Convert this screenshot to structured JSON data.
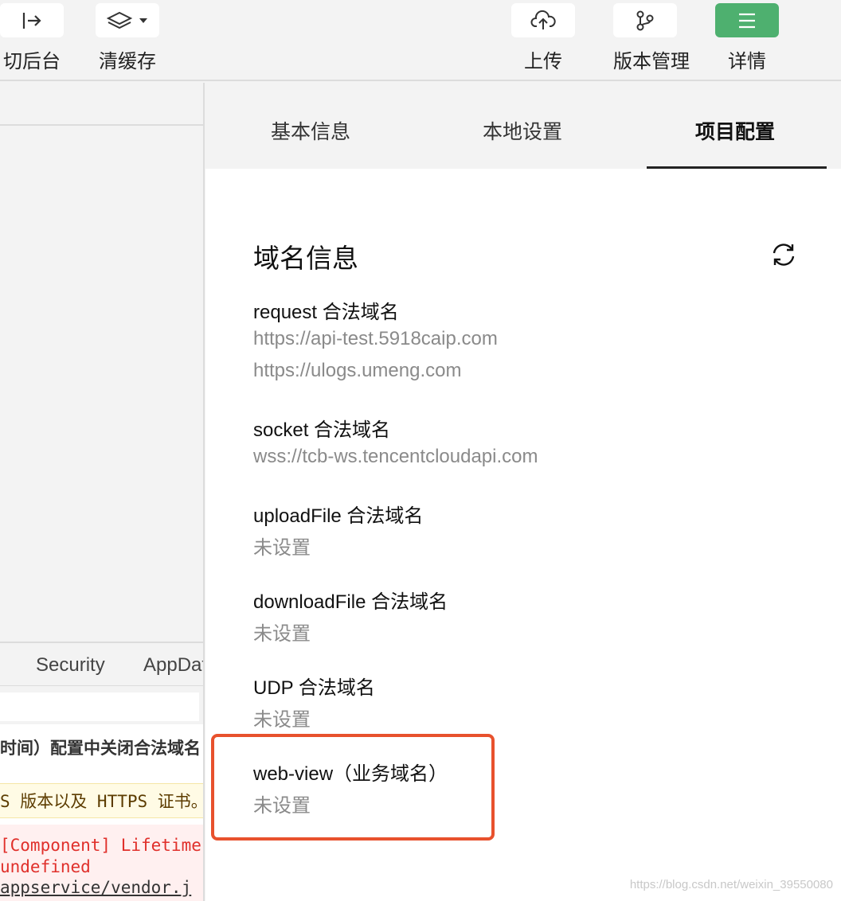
{
  "toolbar": {
    "switch_bg_label": "切后台",
    "clear_cache_label": "清缓存",
    "upload_label": "上传",
    "version_label": "版本管理",
    "details_label": "详情"
  },
  "left": {
    "tabs": [
      "Security",
      "AppDat"
    ],
    "console": {
      "line1": "时间）配置中关闭合法域名",
      "line2": "S 版本以及 HTTPS 证书。",
      "line3": "[Component] Lifetime",
      "line4": "undefined",
      "line5": "appservice/vendor.j"
    }
  },
  "right": {
    "tabs": [
      "基本信息",
      "本地设置",
      "项目配置"
    ],
    "active_tab": "项目配置",
    "section_title": "域名信息",
    "domains": [
      {
        "label": "request 合法域名",
        "values": [
          "https://api-test.5918caip.com",
          "https://ulogs.umeng.com"
        ]
      },
      {
        "label": "socket 合法域名",
        "values": [
          "wss://tcb-ws.tencentcloudapi.com"
        ]
      },
      {
        "label": "uploadFile 合法域名",
        "values": [
          "未设置"
        ]
      },
      {
        "label": "downloadFile 合法域名",
        "values": [
          "未设置"
        ]
      },
      {
        "label": "UDP 合法域名",
        "values": [
          "未设置"
        ]
      },
      {
        "label": "web-view（业务域名）",
        "values": [
          "未设置"
        ]
      }
    ]
  },
  "watermark": "https://blog.csdn.net/weixin_39550080",
  "colors": {
    "accent_green": "#4eb06f",
    "highlight_red": "#e8512d"
  }
}
